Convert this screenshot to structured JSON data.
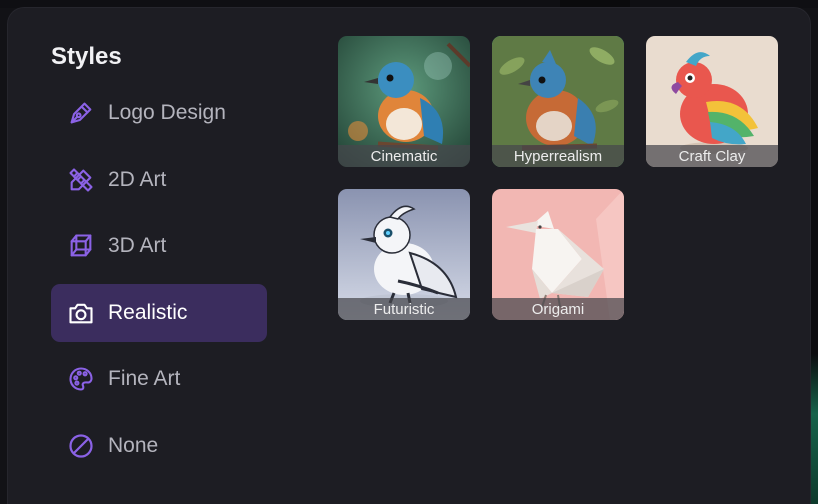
{
  "panel": {
    "title": "Styles"
  },
  "nav": {
    "items": [
      {
        "label": "Logo Design",
        "icon": "pen-nib-icon"
      },
      {
        "label": "2D Art",
        "icon": "pencil-ruler-icon"
      },
      {
        "label": "3D Art",
        "icon": "cube-icon"
      },
      {
        "label": "Realistic",
        "icon": "camera-icon",
        "active": true
      },
      {
        "label": "Fine Art",
        "icon": "palette-icon"
      },
      {
        "label": "None",
        "icon": "slash-circle-icon"
      }
    ]
  },
  "styles": {
    "cards": [
      {
        "label": "Cinematic"
      },
      {
        "label": "Hyperrealism",
        "selected": true
      },
      {
        "label": "Craft Clay"
      },
      {
        "label": "Futuristic"
      },
      {
        "label": "Origami"
      }
    ]
  },
  "colors": {
    "accent": "#8b62e6",
    "active_bg": "#3b2d5e",
    "selected_border": "#40c894",
    "panel_bg": "#1d1d23"
  }
}
